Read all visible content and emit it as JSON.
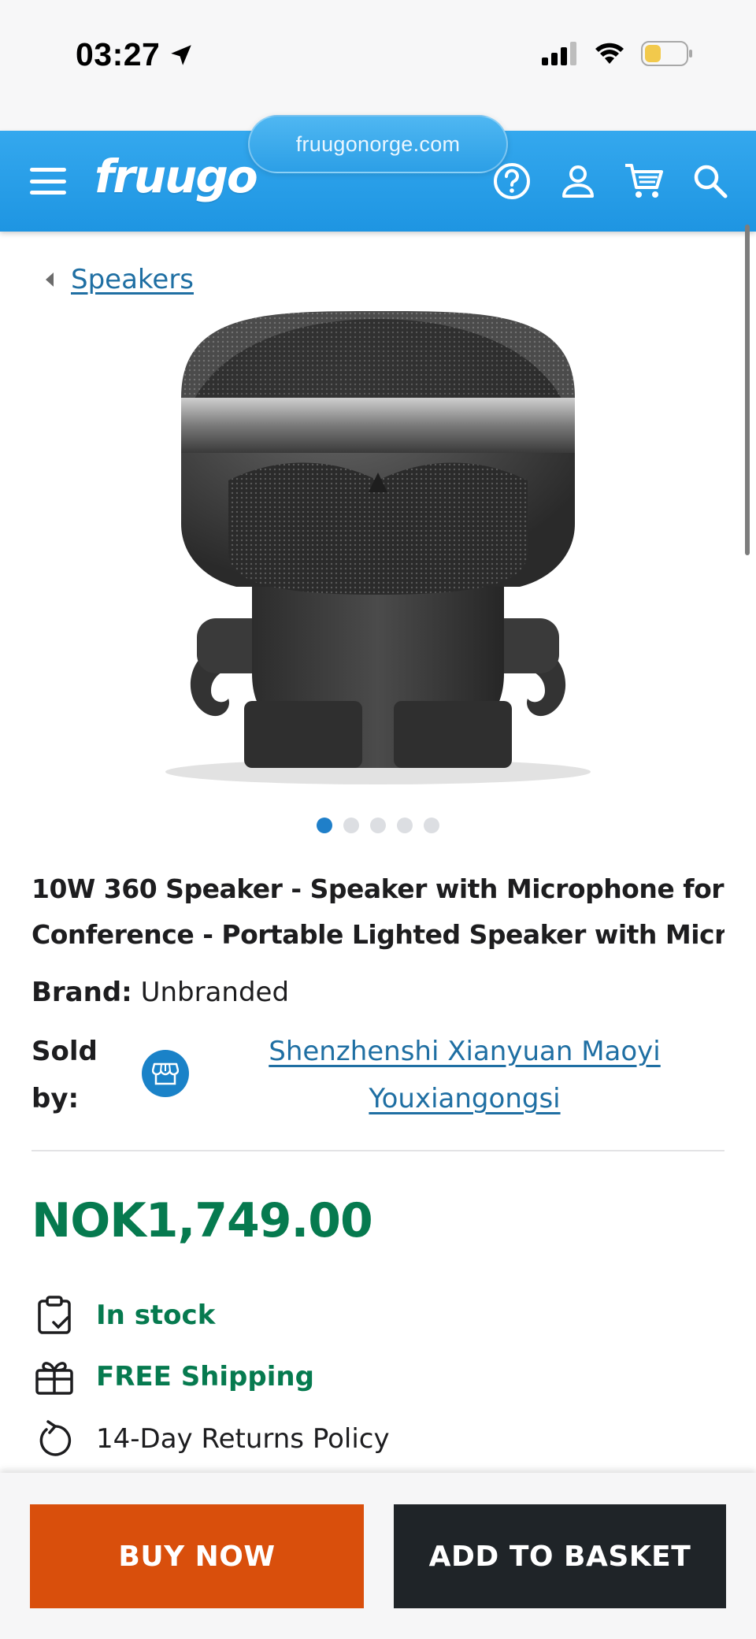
{
  "status_bar": {
    "time": "03:27",
    "icons": [
      "location-arrow-icon",
      "signal-icon",
      "wifi-icon",
      "battery-icon"
    ],
    "battery_color": "#f2c94c"
  },
  "browser": {
    "url": "fruugonorge.com"
  },
  "header": {
    "logo_text": "fruugo",
    "background": "#2a9fe8",
    "icons": [
      "menu-icon",
      "help-icon",
      "account-icon",
      "cart-icon",
      "search-icon"
    ]
  },
  "breadcrumb": {
    "label": "Speakers"
  },
  "carousel": {
    "total": 5,
    "active_index": 0
  },
  "product": {
    "title_line1": "10W 360 Speaker - Speaker with Microphone for",
    "title_line2": "Conference - Portable Lighted Speaker with Micro S...",
    "brand_label": "Brand:",
    "brand_value": "Unbranded",
    "sold_by_label_1": "Sold",
    "sold_by_label_2": "by:",
    "seller_line1": "Shenzhenshi Xianyuan Maoyi",
    "seller_line2": "Youxiangongsi",
    "price": "NOK1,749.00",
    "price_color": "#067a4f"
  },
  "features": {
    "stock": "In stock",
    "shipping": "FREE Shipping",
    "returns": "14-Day Returns Policy"
  },
  "actions": {
    "buy_now": "BUY NOW",
    "add_to_basket": "ADD TO BASKET",
    "buy_color": "#d94f0c",
    "basket_color": "#1f2428"
  }
}
